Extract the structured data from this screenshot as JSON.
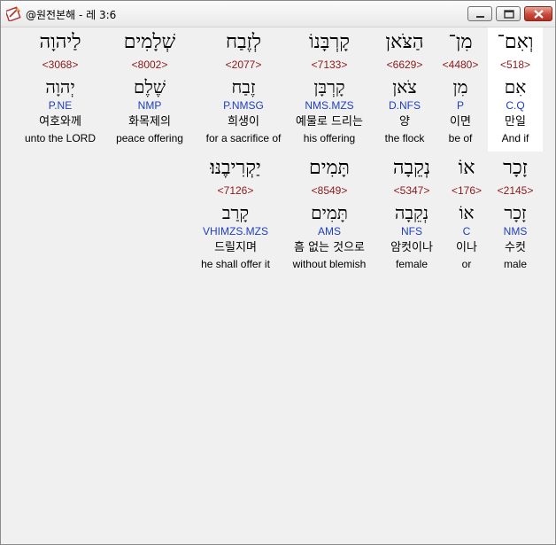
{
  "window": {
    "title": "@원전본해 - 레 3:6"
  },
  "words": [
    {
      "hebrew": "וְאִם־",
      "strong": "<518>",
      "root": "אִם",
      "morph": "C.Q",
      "korean": "만일",
      "english": "And if",
      "highlighted": true
    },
    {
      "hebrew": "מִן־",
      "strong": "<4480>",
      "root": "מִן",
      "morph": "P",
      "korean": "이면",
      "english": "be of"
    },
    {
      "hebrew": "הַצֹּאן",
      "strong": "<6629>",
      "root": "צֹאן",
      "morph": "D.NFS",
      "korean": "양",
      "english": "the flock"
    },
    {
      "hebrew": "קָרְבָּנוֹ",
      "strong": "<7133>",
      "root": "קָרְבָּן",
      "morph": "NMS.MZS",
      "korean": "예물로 드리는",
      "english": "his offering"
    },
    {
      "hebrew": "לְזֶבַח",
      "strong": "<2077>",
      "root": "זֶבַח",
      "morph": "P.NMSG",
      "korean": "희생이",
      "english": "for a sacrifice of"
    },
    {
      "hebrew": "שְׁלָמִים",
      "strong": "<8002>",
      "root": "שֶׁלֶם",
      "morph": "NMP",
      "korean": "화목제의",
      "english": "peace offering"
    },
    {
      "hebrew": "לַיהוָה",
      "strong": "<3068>",
      "root": "יְהוָה",
      "morph": "P.NE",
      "korean": "여호와께",
      "english": "unto the LORD"
    },
    {
      "hebrew": "זָכָר",
      "strong": "<2145>",
      "root": "זָכָר",
      "morph": "NMS",
      "korean": "수컷",
      "english": "male"
    },
    {
      "hebrew": "אוֹ",
      "strong": "<176>",
      "root": "אוֹ",
      "morph": "C",
      "korean": "이나",
      "english": "or"
    },
    {
      "hebrew": "נְקֵבָה",
      "strong": "<5347>",
      "root": "נְקֵבָה",
      "morph": "NFS",
      "korean": "암컷이나",
      "english": "female"
    },
    {
      "hebrew": "תָּמִים",
      "strong": "<8549>",
      "root": "תָּמִים",
      "morph": "AMS",
      "korean": "흠 없는 것으로",
      "english": "without blemish"
    },
    {
      "hebrew": "יַקְרִיבֶנּוּ׃",
      "strong": "<7126>",
      "root": "קָרַב",
      "morph": "VHIMZS.MZS",
      "korean": "드릴지며",
      "english": "he shall offer it"
    }
  ]
}
